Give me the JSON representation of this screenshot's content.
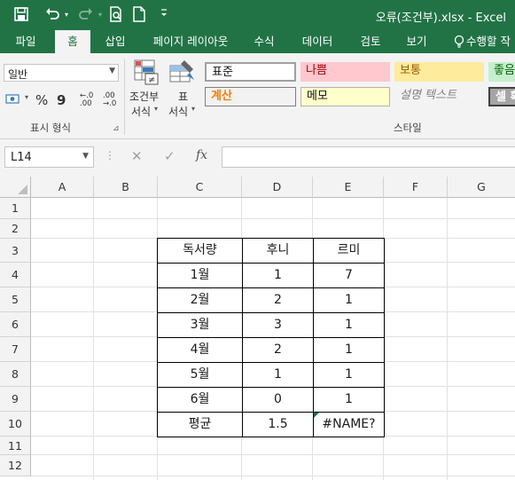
{
  "app": {
    "title": "오류(조건부).xlsx - Excel"
  },
  "quick_access": {
    "icons": [
      "save-icon",
      "undo-icon",
      "redo-icon",
      "print-preview-icon",
      "new-file-icon",
      "customize-qat-icon"
    ]
  },
  "tabs": [
    {
      "label": "파일"
    },
    {
      "label": "홈"
    },
    {
      "label": "삽입"
    },
    {
      "label": "페이지 레이아웃"
    },
    {
      "label": "수식"
    },
    {
      "label": "데이터"
    },
    {
      "label": "검토"
    },
    {
      "label": "보기"
    },
    {
      "label": "수행할 작"
    }
  ],
  "ribbon": {
    "number_group": {
      "format_value": "일반",
      "percent_label": "%",
      "comma_label": "9",
      "increase_decimal_label": "←.0 .00",
      "decrease_decimal_label": ".00 →.0",
      "group_label": "표시 형식"
    },
    "cond_format": {
      "line1": "조건부",
      "line2": "서식"
    },
    "table_format": {
      "line1": "표",
      "line2": "서식"
    },
    "styles": {
      "group_label": "스타일",
      "items": [
        {
          "label": "표준"
        },
        {
          "label": "나쁨"
        },
        {
          "label": "보통"
        },
        {
          "label": "좋음"
        },
        {
          "label": "계산"
        },
        {
          "label": "메모"
        },
        {
          "label": "설명 텍스트"
        },
        {
          "label": "셀 확"
        }
      ]
    }
  },
  "formula_bar": {
    "name_box": "L14",
    "cancel_label": "✕",
    "enter_label": "✓",
    "fx_label": "fx",
    "formula": ""
  },
  "sheet": {
    "columns": [
      "A",
      "B",
      "C",
      "D",
      "E",
      "F",
      "G"
    ],
    "rows": [
      "1",
      "2",
      "3",
      "4",
      "5",
      "6",
      "7",
      "8",
      "9",
      "10",
      "11",
      "12"
    ],
    "table": {
      "header": [
        "독서량",
        "후니",
        "르미"
      ],
      "body": [
        [
          "1월",
          "1",
          "7"
        ],
        [
          "2월",
          "2",
          "1"
        ],
        [
          "3월",
          "3",
          "1"
        ],
        [
          "4월",
          "2",
          "1"
        ],
        [
          "5월",
          "1",
          "1"
        ],
        [
          "6월",
          "0",
          "1"
        ],
        [
          "평균",
          "1.5",
          "#NAME?"
        ]
      ]
    },
    "error_indicator_color": "#217346"
  },
  "colors": {
    "accent": "#217346",
    "bad_fill": "#ffc7ce",
    "bad_text": "#9c0006",
    "neutral_fill": "#ffeb9c",
    "neutral_text": "#9c5700",
    "good_fill": "#c6efce",
    "good_text": "#006100",
    "calc_fill": "#f2f2f2",
    "calc_text": "#fa7d00",
    "note_fill": "#ffffcc"
  }
}
